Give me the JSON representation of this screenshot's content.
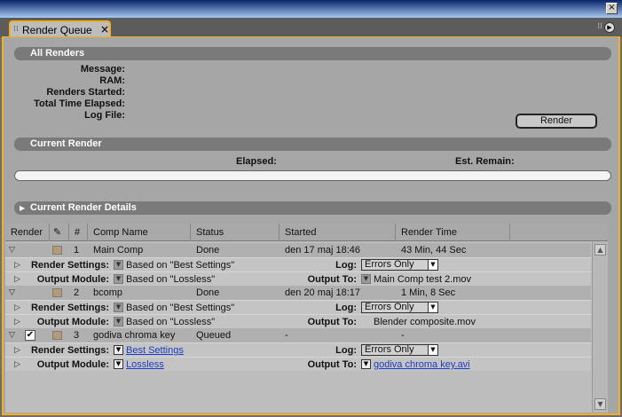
{
  "window": {
    "close_glyph": "×"
  },
  "tab": {
    "title": "Render Queue",
    "close_glyph": "×",
    "grip_glyph": "⁞⁞"
  },
  "panel_menu_glyph": "▶",
  "all_renders": {
    "title": "All Renders",
    "labels": [
      "Message:",
      "RAM:",
      "Renders Started:",
      "Total Time Elapsed:",
      "Log File:"
    ],
    "render_button": "Render"
  },
  "current_render": {
    "title": "Current Render",
    "elapsed_label": "Elapsed:",
    "remain_label": "Est. Remain:",
    "progress": 0
  },
  "details": {
    "title": "Current Render Details",
    "twisty": "▶"
  },
  "columns": [
    "Render",
    "",
    "#",
    "Comp Name",
    "Status",
    "Started",
    "Render Time"
  ],
  "icons": {
    "clip": "✎",
    "expanded": "▽",
    "collapsed": "▷",
    "check": "✔",
    "dd": "▼",
    "scroll_up": "▲",
    "scroll_down": "▼"
  },
  "settings_label": "Render Settings:",
  "output_label": "Output Module:",
  "log_label": "Log:",
  "output_to_label": "Output To:",
  "jobs": [
    {
      "num": "1",
      "comp": "Main Comp",
      "status": "Done",
      "started": "den 17 maj 18:46",
      "time": "43 Min, 44 Sec",
      "checked": false,
      "settings": "Based on \"Best Settings\"",
      "output": "Based on \"Lossless\"",
      "log": "Errors Only",
      "output_to": "Main Comp test 2.mov"
    },
    {
      "num": "2",
      "comp": "bcomp",
      "status": "Done",
      "started": "den 20 maj 18:17",
      "time": "1 Min, 8 Sec",
      "checked": false,
      "settings": "Based on \"Best Settings\"",
      "output": "Based on \"Lossless\"",
      "log": "Errors Only",
      "output_to": "Blender composite.mov"
    },
    {
      "num": "3",
      "comp": "godiva chroma key",
      "status": "Queued",
      "started": "-",
      "time": "-",
      "checked": true,
      "settings": "Best Settings",
      "output": "Lossless",
      "log": "Errors Only",
      "output_to": "godiva chroma key.avi"
    }
  ]
}
